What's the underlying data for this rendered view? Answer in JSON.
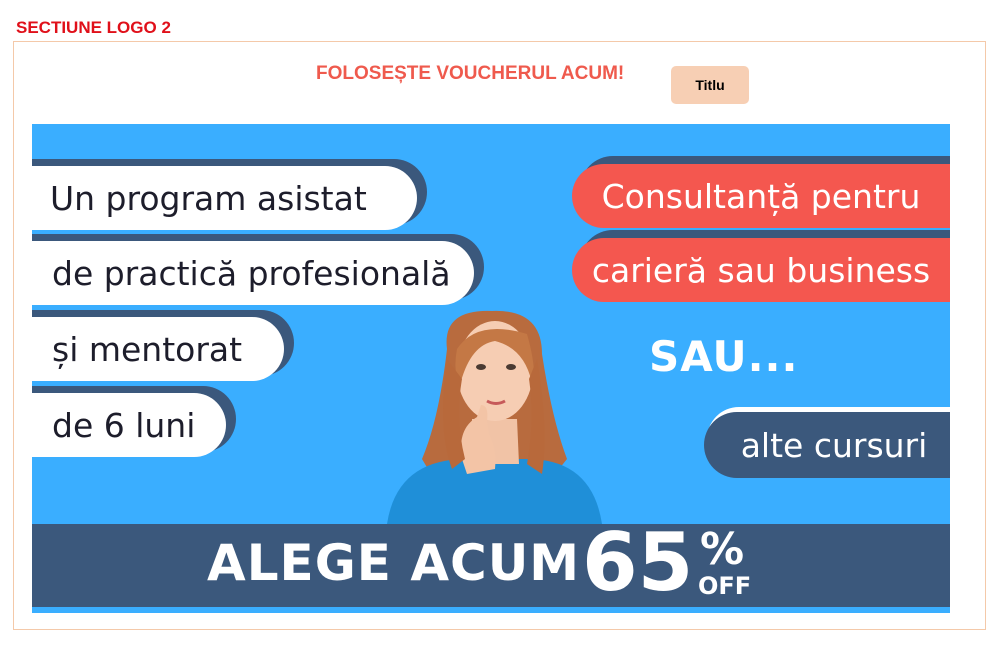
{
  "section": {
    "label": "SECTIUNE LOGO 2"
  },
  "header": {
    "title": "FOLOSEȘTE VOUCHERUL ACUM!",
    "tag": "Titlu"
  },
  "banner": {
    "left_lines": [
      "Un program asistat",
      "de practică profesională",
      "și mentorat",
      "de 6 luni"
    ],
    "right_lines": [
      "Consultanță pentru",
      "carieră sau business"
    ],
    "or_text": "SAU...",
    "other_courses": "alte cursuri",
    "cta": "ALEGE ACUM",
    "discount_number": "65",
    "discount_percent": "%",
    "discount_off": "OFF"
  },
  "colors": {
    "section_label": "#e0101a",
    "title": "#ef5a4d",
    "tag_bg": "#f7cfb4",
    "banner_bg": "#3aaeff",
    "navy": "#3b587c",
    "coral": "#f4574f"
  },
  "icons": {
    "person_image": "woman-thinking-photo"
  }
}
